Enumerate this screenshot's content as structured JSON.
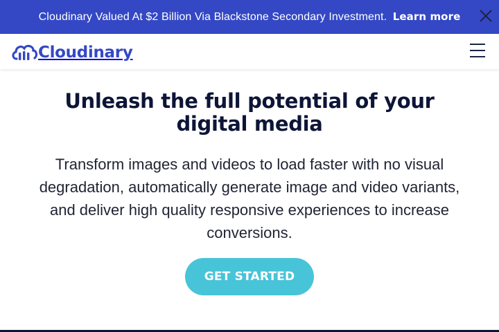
{
  "announcement": {
    "text": "Cloudinary Valued At $2 Billion Via Blackstone Secondary Investment.",
    "link_label": "Learn more",
    "close_icon": "close-icon",
    "background": "#3448c5"
  },
  "header": {
    "brand_name": "Cloudinary",
    "logo_icon": "cloud-logo-icon",
    "menu_icon": "hamburger-menu-icon",
    "brand_color": "#3448c5"
  },
  "hero": {
    "title": "Unleash the full potential of your digital media",
    "description": "Transform images and videos to load faster with no visual degradation, automatically generate image and video variants, and deliver high quality responsive experiences to increase conversions.",
    "cta_label": "GET STARTED",
    "cta_color": "#48c4d8",
    "title_color": "#0d1537"
  }
}
